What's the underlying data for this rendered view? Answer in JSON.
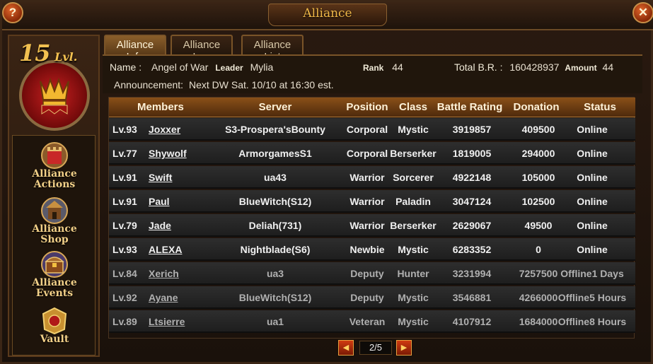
{
  "window": {
    "title": "Alliance",
    "help_label": "?",
    "close_label": "✕"
  },
  "alliance_badge": {
    "level": "15",
    "level_suffix": "Lvl."
  },
  "left_nav": [
    {
      "icon": "castle-icon",
      "label_line1": "Alliance",
      "label_line2": "Actions"
    },
    {
      "icon": "shop-icon",
      "label_line1": "Alliance",
      "label_line2": "Shop"
    },
    {
      "icon": "treasure-icon",
      "label_line1": "Alliance",
      "label_line2": "Events"
    },
    {
      "icon": "vault-icon",
      "label_line1": "Vault",
      "label_line2": ""
    }
  ],
  "tabs": [
    {
      "label": "Alliance Info",
      "active": true
    },
    {
      "label": "Alliance Log",
      "active": false
    },
    {
      "label": "Alliance List",
      "active": false
    }
  ],
  "info": {
    "name_label": "Name :",
    "name_value": "Angel of War",
    "leader_label": "Leader",
    "leader_value": "Mylia",
    "rank_label": "Rank",
    "rank_value": "44",
    "total_br_label": "Total B.R. :",
    "total_br_value": "160428937",
    "amount_label": "Amount",
    "amount_value": "44",
    "announcement_label": "Announcement:",
    "announcement_value": "Next DW Sat. 10/10 at 16:30 est."
  },
  "table": {
    "headers": [
      "Members",
      "Server",
      "Position",
      "Class",
      "Battle Rating",
      "Donation",
      "Status"
    ],
    "rows": [
      {
        "level": "Lv.93",
        "name": "Joxxer",
        "server": "S3-Prospera'sBounty",
        "position": "Corporal",
        "class": "Mystic",
        "battle_rating": "3919857",
        "donation": "409500",
        "status": "Online"
      },
      {
        "level": "Lv.77",
        "name": "Shywolf",
        "server": "ArmorgamesS1",
        "position": "Corporal",
        "class": "Berserker",
        "battle_rating": "1819005",
        "donation": "294000",
        "status": "Online"
      },
      {
        "level": "Lv.91",
        "name": "Swift",
        "server": "ua43",
        "position": "Warrior",
        "class": "Sorcerer",
        "battle_rating": "4922148",
        "donation": "105000",
        "status": "Online"
      },
      {
        "level": "Lv.91",
        "name": "Paul",
        "server": "BlueWitch(S12)",
        "position": "Warrior",
        "class": "Paladin",
        "battle_rating": "3047124",
        "donation": "102500",
        "status": "Online"
      },
      {
        "level": "Lv.79",
        "name": "Jade",
        "server": "Deliah(731)",
        "position": "Warrior",
        "class": "Berserker",
        "battle_rating": "2629067",
        "donation": "49500",
        "status": "Online"
      },
      {
        "level": "Lv.93",
        "name": "ALEXA",
        "server": "Nightblade(S6)",
        "position": "Newbie",
        "class": "Mystic",
        "battle_rating": "6283352",
        "donation": "0",
        "status": "Online"
      },
      {
        "level": "Lv.84",
        "name": "Xerich",
        "server": "ua3",
        "position": "Deputy",
        "class": "Hunter",
        "battle_rating": "3231994",
        "donation": "7257500",
        "status": "Offline1 Days"
      },
      {
        "level": "Lv.92",
        "name": "Ayane",
        "server": "BlueWitch(S12)",
        "position": "Deputy",
        "class": "Mystic",
        "battle_rating": "3546881",
        "donation": "4266000",
        "status": "Offline5 Hours"
      },
      {
        "level": "Lv.89",
        "name": "Ltsierre",
        "server": "ua1",
        "position": "Veteran",
        "class": "Mystic",
        "battle_rating": "4107912",
        "donation": "1684000",
        "status": "Offline8 Hours"
      }
    ]
  },
  "pager": {
    "page_text": "2/5",
    "prev_icon": "arrow-left-icon",
    "next_icon": "arrow-right-icon"
  },
  "colors": {
    "accent_gold": "#f0b848",
    "header_brown": "#8a5018",
    "online_text": "#f0f0f0",
    "offline_text": "#b0b0b0"
  }
}
